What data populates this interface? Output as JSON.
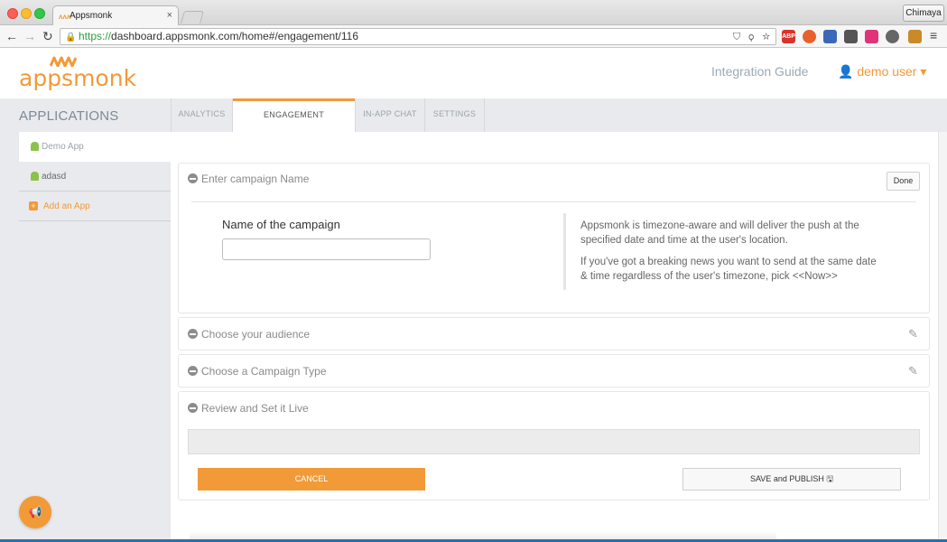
{
  "browser": {
    "tab_title": "Appsmonk",
    "tab_close": "×",
    "profile_name": "Chimaya",
    "url_scheme": "https://",
    "url_rest": "dashboard.appsmonk.com/home#/engagement/116",
    "ext_abp": "ABP"
  },
  "header": {
    "logo_text": "appsmonk",
    "integration_guide": "Integration Guide",
    "user_menu": "demo user ▾",
    "user_icon": "user-icon"
  },
  "sidebar": {
    "title": "APPLICATIONS",
    "items": [
      {
        "label": "Demo App",
        "icon": "android-icon",
        "active": true
      },
      {
        "label": "adasd",
        "icon": "android-icon",
        "active": false
      },
      {
        "label": "Add an App",
        "icon": "plus-icon",
        "active": false
      }
    ]
  },
  "tabs": [
    {
      "label": "ANALYTICS"
    },
    {
      "label": "ENGAGEMENT",
      "active": true
    },
    {
      "label": "IN-APP CHAT"
    },
    {
      "label": "SETTINGS"
    }
  ],
  "campaign": {
    "section1_title": "Enter campaign Name",
    "done_label": "Done",
    "field_label": "Name of the campaign",
    "field_value": "",
    "info_line1": "Appsmonk is timezone-aware and will deliver the push at the specified date and time at the user's location.",
    "info_line2": "If you've got a breaking news you want to send at the same date & time regardless of the user's timezone, pick <<Now>>",
    "section2_title": "Choose your audience",
    "section3_title": "Choose a Campaign Type",
    "section4_title": "Review and Set it Live",
    "cancel_label": "CANCEL",
    "save_label": "SAVE and PUBLISH 🖫"
  },
  "colors": {
    "accent": "#f29a38",
    "sidebar_bg": "#e9eaed",
    "link_grey": "#9aaab5"
  }
}
